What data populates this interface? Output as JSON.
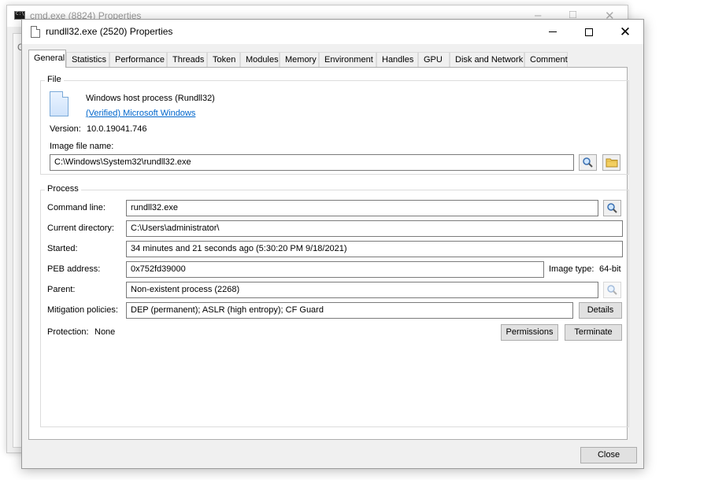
{
  "background_window": {
    "title": "cmd.exe (8824) Properties",
    "partial_label": "G"
  },
  "window": {
    "title": "rundll32.exe (2520) Properties",
    "icon": "document-icon",
    "controls": {
      "minimize": "minimize-icon",
      "maximize": "maximize-icon",
      "close": "close-icon"
    }
  },
  "tabs": [
    {
      "label": "General",
      "active": true
    },
    {
      "label": "Statistics"
    },
    {
      "label": "Performance"
    },
    {
      "label": "Threads"
    },
    {
      "label": "Token"
    },
    {
      "label": "Modules"
    },
    {
      "label": "Memory"
    },
    {
      "label": "Environment"
    },
    {
      "label": "Handles"
    },
    {
      "label": "GPU"
    },
    {
      "label": "Disk and Network"
    },
    {
      "label": "Comment"
    }
  ],
  "file": {
    "group_title": "File",
    "description": "Windows host process (Rundll32)",
    "verified": "(Verified) Microsoft Windows",
    "version_label": "Version:",
    "version_value": "10.0.19041.746",
    "image_label": "Image file name:",
    "image_path": "C:\\Windows\\System32\\rundll32.exe"
  },
  "process": {
    "group_title": "Process",
    "command_line_label": "Command line:",
    "command_line": "rundll32.exe",
    "current_dir_label": "Current directory:",
    "current_dir": "C:\\Users\\administrator\\",
    "started_label": "Started:",
    "started": "34 minutes and 21 seconds ago (5:30:20 PM 9/18/2021)",
    "peb_label": "PEB address:",
    "peb": "0x752fd39000",
    "image_type_label": "Image type:",
    "image_type": "64-bit",
    "parent_label": "Parent:",
    "parent": "Non-existent process (2268)",
    "mitigation_label": "Mitigation policies:",
    "mitigation": "DEP (permanent); ASLR (high entropy); CF Guard",
    "details_button": "Details",
    "protection_label": "Protection:",
    "protection": "None",
    "permissions_button": "Permissions",
    "terminate_button": "Terminate"
  },
  "footer": {
    "close_button": "Close"
  }
}
